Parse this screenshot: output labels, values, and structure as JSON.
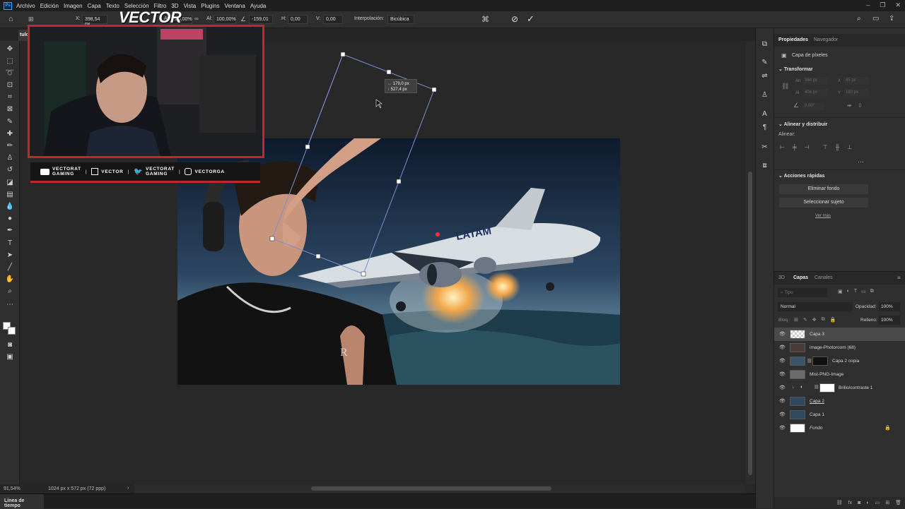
{
  "app": {
    "logo": "Ps"
  },
  "menu": [
    "Archivo",
    "Edición",
    "Imagen",
    "Capa",
    "Texto",
    "Selección",
    "Filtro",
    "3D",
    "Vista",
    "Plugins",
    "Ventana",
    "Ayuda"
  ],
  "options": {
    "x_label": "X:",
    "x_value": "398,54 px",
    "w_label": "An:",
    "w_value": "100,00%",
    "h_label": "Al:",
    "h_value": "100,00%",
    "angle_value": "-159,01",
    "hskew_label": "H:",
    "hskew_value": "0,00",
    "vskew_label": "V:",
    "vskew_value": "0,00",
    "interp_label": "Interpolación:",
    "interp_value": "Bicúbica",
    "cancel_icon": "cancel-icon",
    "commit_icon": "check-icon"
  },
  "document": {
    "tab": "tulo"
  },
  "transform_readout": {
    "w": "179,0 px",
    "h": "527,4 px"
  },
  "overlay": {
    "brand": "VECTOR",
    "socials": [
      {
        "icon": "youtube-icon",
        "text": "VECTORAT\nGAMING"
      },
      {
        "icon": "twitch-icon",
        "text": "VECTOR"
      },
      {
        "icon": "twitter-icon",
        "text": "VECTORAT\nGAMING"
      },
      {
        "icon": "instagram-icon",
        "text": "VECTORGA"
      }
    ],
    "accent": "#c1272d"
  },
  "artwork": {
    "airline_text": "LATAM"
  },
  "status": {
    "zoom": "91,54%",
    "doc_info": "1024 px x 572 px (72 ppp)"
  },
  "timeline": {
    "tab": "Línea de tiempo"
  },
  "properties": {
    "tabs": [
      "Propiedades",
      "Navegador"
    ],
    "layer_kind": "Capa de píxeles",
    "transform_title": "Transformar",
    "an": "An",
    "an_value": "364 px",
    "x": "X",
    "x_value": "45 px",
    "al": "Al",
    "al_value": "404 px",
    "y": "Y",
    "y_value": "160 px",
    "angle": "0,00°",
    "align_title": "Alinear y distribuir",
    "align_label": "Alinear:",
    "quick_title": "Acciones rápidas",
    "btn_remove_bg": "Eliminar fondo",
    "btn_select_subject": "Seleccionar sujeto",
    "see_more": "Ver más"
  },
  "layers_panel": {
    "tabs": [
      "3D",
      "Capas",
      "Canales"
    ],
    "search": "Tipo",
    "blend": "Normal",
    "opacity_label": "Opacidad:",
    "opacity": "100%",
    "lock_label": "Bloq.:",
    "fill_label": "Relleno:",
    "fill": "100%",
    "layers": [
      {
        "name": "Capa 3",
        "selected": true
      },
      {
        "name": "image-Photoroom (68)"
      },
      {
        "name": "Capa 2 copia"
      },
      {
        "name": "Mist-PNG-Image"
      },
      {
        "name": "Brillo/contraste 1"
      },
      {
        "name": "Capa 2"
      },
      {
        "name": "Capa 1"
      },
      {
        "name": "Fondo",
        "locked": true
      }
    ]
  }
}
